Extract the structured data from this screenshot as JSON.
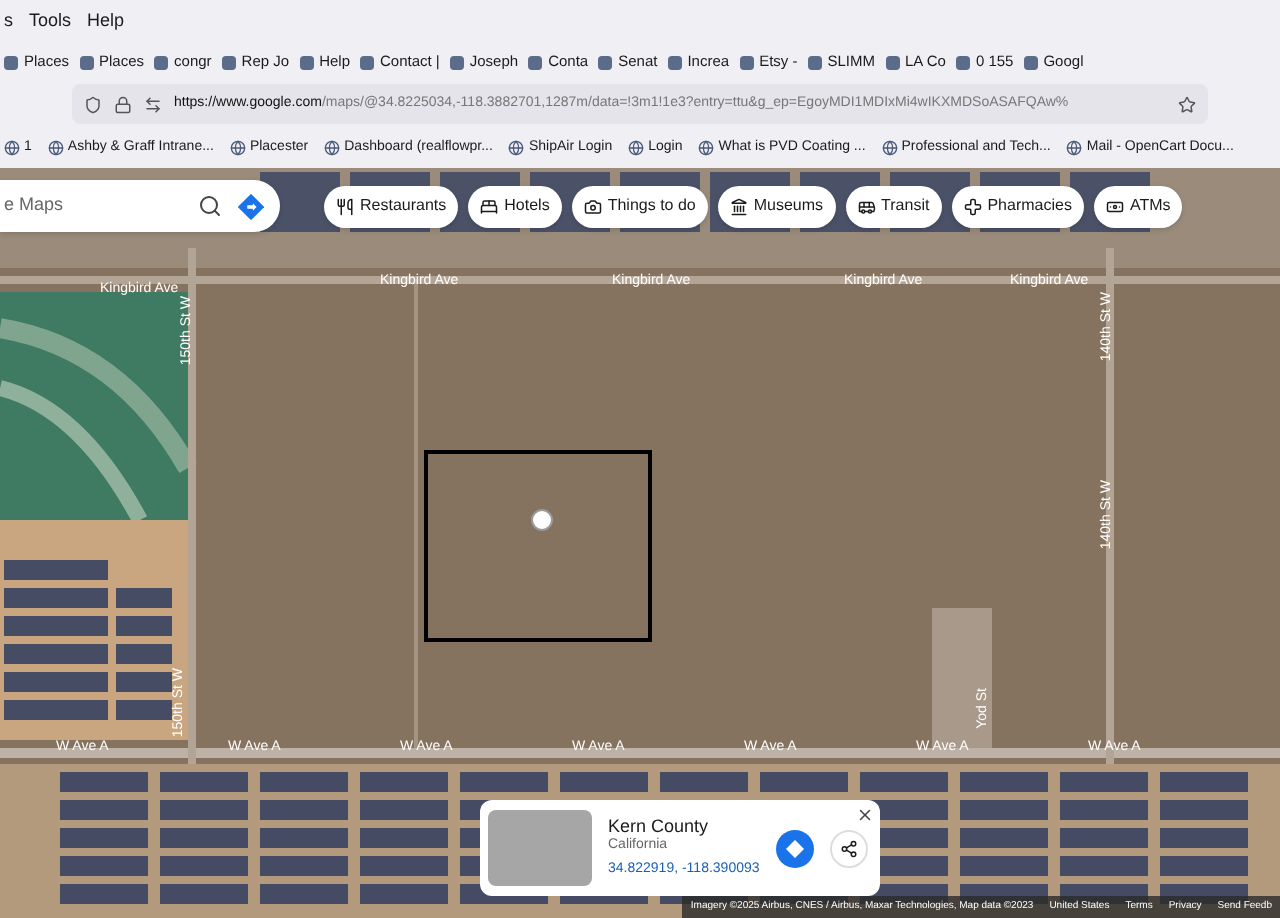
{
  "menu": [
    "s",
    "Tools",
    "Help"
  ],
  "tabs": [
    {
      "label": "Places"
    },
    {
      "label": "Places"
    },
    {
      "label": "congr"
    },
    {
      "label": "Rep Jo"
    },
    {
      "label": "Help"
    },
    {
      "label": "Contact |"
    },
    {
      "label": "Joseph"
    },
    {
      "label": "Conta"
    },
    {
      "label": "Senat"
    },
    {
      "label": "Increa"
    },
    {
      "label": "Etsy -"
    },
    {
      "label": "SLIMM"
    },
    {
      "label": "LA Co"
    },
    {
      "label": "0 155"
    },
    {
      "label": "Googl"
    }
  ],
  "address_bar": {
    "url_host": "https://www.google.com",
    "url_path": "/maps/@34.8225034,-118.3882701,1287m/data=!3m1!1e3?entry=ttu&g_ep=EgoyMDI1MDIxMi4wIKXMDSoASAFQAw%"
  },
  "bookmarks": [
    {
      "label": "1"
    },
    {
      "label": "Ashby & Graff Intrane..."
    },
    {
      "label": "Placester"
    },
    {
      "label": "Dashboard (realflowpr..."
    },
    {
      "label": "ShipAir Login"
    },
    {
      "label": "Login"
    },
    {
      "label": "What is PVD Coating ..."
    },
    {
      "label": "Professional and Tech..."
    },
    {
      "label": "Mail - OpenCart Docu..."
    }
  ],
  "search": {
    "placeholder": "e Maps"
  },
  "chips": [
    {
      "kind": "restaurants",
      "label": "Restaurants"
    },
    {
      "kind": "hotels",
      "label": "Hotels"
    },
    {
      "kind": "things",
      "label": "Things to do"
    },
    {
      "kind": "museums",
      "label": "Museums"
    },
    {
      "kind": "transit",
      "label": "Transit"
    },
    {
      "kind": "pharmacies",
      "label": "Pharmacies"
    },
    {
      "kind": "atms",
      "label": "ATMs"
    }
  ],
  "map_labels": [
    {
      "kind": "h",
      "text": "Kingbird Ave"
    },
    {
      "kind": "h",
      "text": "Kingbird Ave"
    },
    {
      "kind": "h",
      "text": "Kingbird Ave"
    },
    {
      "kind": "h",
      "text": "Kingbird Ave"
    },
    {
      "kind": "h",
      "text": "Kingbird Ave"
    },
    {
      "kind": "h",
      "text": "W Ave A"
    },
    {
      "kind": "h",
      "text": "W Ave A"
    },
    {
      "kind": "h",
      "text": "W Ave A"
    },
    {
      "kind": "h",
      "text": "W Ave A"
    },
    {
      "kind": "h",
      "text": "W Ave A"
    },
    {
      "kind": "h",
      "text": "W Ave A"
    },
    {
      "kind": "h",
      "text": "W Ave A"
    },
    {
      "kind": "v",
      "text": "150th St W"
    },
    {
      "kind": "v",
      "text": "150th St W"
    },
    {
      "kind": "v",
      "text": "140th St W"
    },
    {
      "kind": "v",
      "text": "140th St W"
    },
    {
      "kind": "v",
      "text": "Yod St"
    }
  ],
  "place_card": {
    "title": "Kern County",
    "subtitle": "California",
    "coordinates": "34.822919, -118.390093"
  },
  "attribution": [
    "Imagery ©2025 Airbus, CNES / Airbus, Maxar Technologies, Map data ©2023",
    "United States",
    "Terms",
    "Privacy",
    "Send Feedb"
  ]
}
